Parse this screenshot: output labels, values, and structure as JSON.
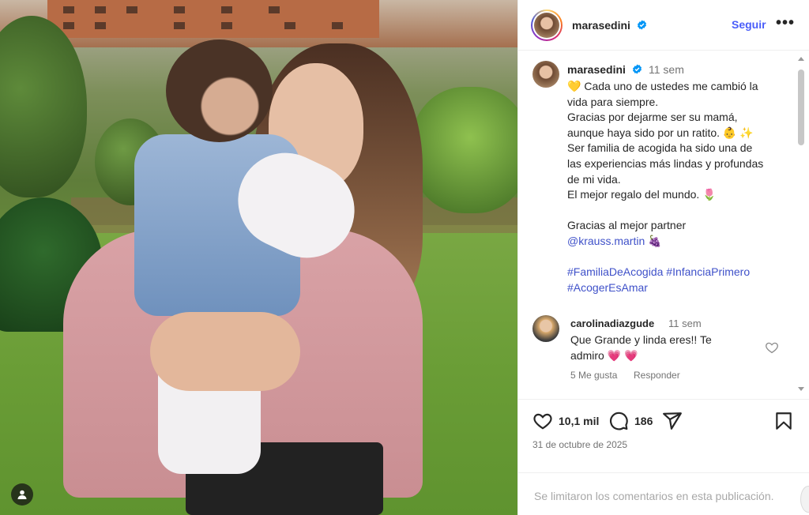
{
  "header": {
    "username": "marasedini",
    "follow_label": "Seguir",
    "more_label": "•••"
  },
  "caption": {
    "username": "marasedini",
    "time": "11 sem",
    "lines": [
      "Cada uno de ustedes me cambió la",
      "vida para siempre.",
      "Gracias por dejarme ser su mamá,",
      "aunque haya sido por un ratito.",
      "Ser familia de acogida ha sido una de",
      "las experiencias más lindas y profundas",
      "de mi vida.",
      "El mejor regalo del mundo.",
      "Gracias al mejor partner",
      "@krauss.martin",
      "#FamiliaDeAcogida",
      "#InfanciaPrimero",
      "#AcogerEsAmar"
    ],
    "emojis": {
      "heart": "💛",
      "baby": "👶",
      "sparkles": "✨",
      "tulip": "🌷",
      "grapes": "🍇"
    }
  },
  "comment": {
    "username": "carolinadiazgude",
    "time": "11 sem",
    "text_line1": "Que Grande y linda eres!! Te",
    "text_line2": "admiro",
    "hearts": "💗 💗",
    "likes": "5 Me gusta",
    "reply_label": "Responder"
  },
  "actions": {
    "likes_count": "10,1 mil",
    "comments_count": "186",
    "date": "31 de octubre de 2025"
  },
  "footer": {
    "limited_text": "Se limitaron los comentarios en esta publicación."
  },
  "colors": {
    "link": "#3f51c9",
    "follow": "#4a5df9",
    "verified": "#0095f6",
    "muted": "#737373"
  },
  "icons": [
    "verified-icon",
    "more-icon",
    "heart-icon",
    "comment-icon",
    "share-icon",
    "save-icon",
    "user-tag-icon"
  ]
}
